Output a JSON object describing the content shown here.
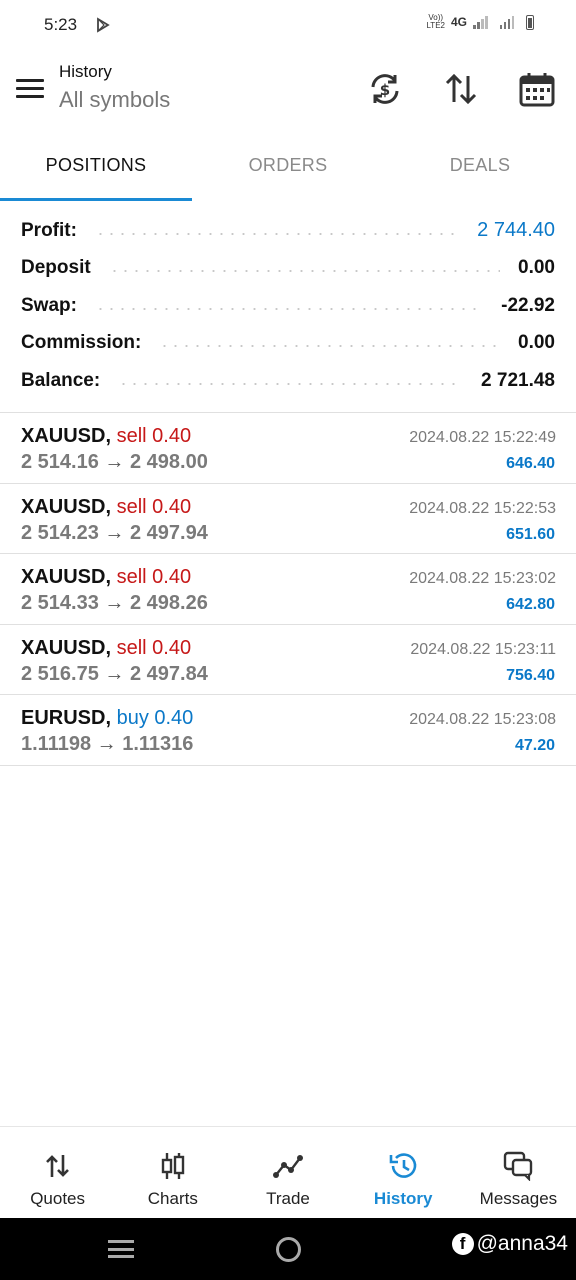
{
  "status_bar": {
    "time": "5:23",
    "volte_top": "Vo))",
    "volte_bottom": "LTE2",
    "network": "4G"
  },
  "app_bar": {
    "title": "History",
    "subtitle": "All symbols"
  },
  "tabs": [
    {
      "label": "POSITIONS",
      "active": true
    },
    {
      "label": "ORDERS",
      "active": false
    },
    {
      "label": "DEALS",
      "active": false
    }
  ],
  "summary": {
    "profit": {
      "label": "Profit:",
      "value": "2 744.40"
    },
    "deposit": {
      "label": "Deposit",
      "value": "0.00"
    },
    "swap": {
      "label": "Swap:",
      "value": "-22.92"
    },
    "commission": {
      "label": "Commission:",
      "value": "0.00"
    },
    "balance": {
      "label": "Balance:",
      "value": "2 721.48"
    }
  },
  "positions": [
    {
      "symbol": "XAUUSD,",
      "side": "sell 0.40",
      "open": "2 514.16",
      "arrow": "→",
      "close": "2 498.00",
      "time": "2024.08.22 15:22:49",
      "profit": "646.40"
    },
    {
      "symbol": "XAUUSD,",
      "side": "sell 0.40",
      "open": "2 514.23",
      "arrow": "→",
      "close": "2 497.94",
      "time": "2024.08.22 15:22:53",
      "profit": "651.60"
    },
    {
      "symbol": "XAUUSD,",
      "side": "sell 0.40",
      "open": "2 514.33",
      "arrow": "→",
      "close": "2 498.26",
      "time": "2024.08.22 15:23:02",
      "profit": "642.80"
    },
    {
      "symbol": "XAUUSD,",
      "side": "sell 0.40",
      "open": "2 516.75",
      "arrow": "→",
      "close": "2 497.84",
      "time": "2024.08.22 15:23:11",
      "profit": "756.40"
    },
    {
      "symbol": "EURUSD,",
      "side": "buy 0.40",
      "open": "1.11198",
      "arrow": "→",
      "close": "1.11316",
      "time": "2024.08.22 15:23:08",
      "profit": "47.20"
    }
  ],
  "bottom_nav": [
    {
      "label": "Quotes",
      "icon": "quotes-icon",
      "active": false
    },
    {
      "label": "Charts",
      "icon": "candlestick-icon",
      "active": false
    },
    {
      "label": "Trade",
      "icon": "trade-icon",
      "active": false
    },
    {
      "label": "History",
      "icon": "history-icon",
      "active": true
    },
    {
      "label": "Messages",
      "icon": "messages-icon",
      "active": false
    }
  ],
  "watermark": {
    "text": "@anna34",
    "icon_letter": "f"
  },
  "colors": {
    "accent": "#1a8ad4",
    "profit_blue": "#0a78c8",
    "sell_red": "#c61818",
    "muted_gray": "#7a7a7a"
  }
}
